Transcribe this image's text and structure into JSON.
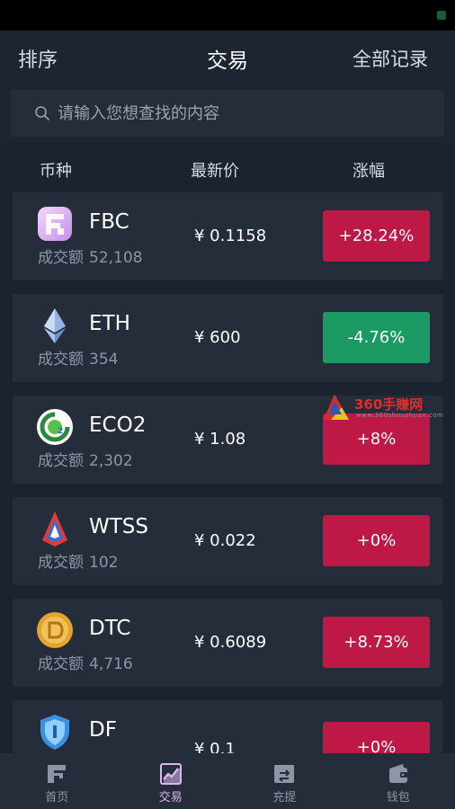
{
  "header": {
    "left_label": "排序",
    "title": "交易",
    "right_label": "全部记录"
  },
  "search": {
    "placeholder": "请输入您想查找的内容"
  },
  "columns": {
    "coin": "币种",
    "price": "最新价",
    "change": "涨幅"
  },
  "volume_label": "成交额",
  "coins": [
    {
      "symbol": "FBC",
      "volume": "52,108",
      "price": "¥ 0.1158",
      "change": "+28.24%",
      "direction": "up",
      "icon": "fbc-logo-icon"
    },
    {
      "symbol": "ETH",
      "volume": "354",
      "price": "¥ 600",
      "change": "-4.76%",
      "direction": "down",
      "icon": "ethereum-icon"
    },
    {
      "symbol": "ECO2",
      "volume": "2,302",
      "price": "¥ 1.08",
      "change": "+8%",
      "direction": "up",
      "icon": "eco2-logo-icon"
    },
    {
      "symbol": "WTSS",
      "volume": "102",
      "price": "¥ 0.022",
      "change": "+0%",
      "direction": "up",
      "icon": "wtss-logo-icon"
    },
    {
      "symbol": "DTC",
      "volume": "4,716",
      "price": "¥ 0.6089",
      "change": "+8.73%",
      "direction": "up",
      "icon": "dtc-coin-icon"
    },
    {
      "symbol": "DF",
      "volume": "",
      "price": "¥ 0.1",
      "change": "+0%",
      "direction": "up",
      "icon": "df-shield-icon"
    }
  ],
  "watermark": {
    "text": "360手赚网",
    "sub": "www.360shouzhuan.com"
  },
  "tabbar": [
    {
      "label": "首页",
      "icon": "home-icon",
      "active": false
    },
    {
      "label": "交易",
      "icon": "trade-chart-icon",
      "active": true
    },
    {
      "label": "充提",
      "icon": "deposit-icon",
      "active": false
    },
    {
      "label": "钱包",
      "icon": "wallet-icon",
      "active": false
    }
  ],
  "colors": {
    "up": "#be1846",
    "down": "#1b9a63",
    "background": "#1b2230",
    "card": "#252d3b",
    "tab_active": "#d8b6f0"
  }
}
